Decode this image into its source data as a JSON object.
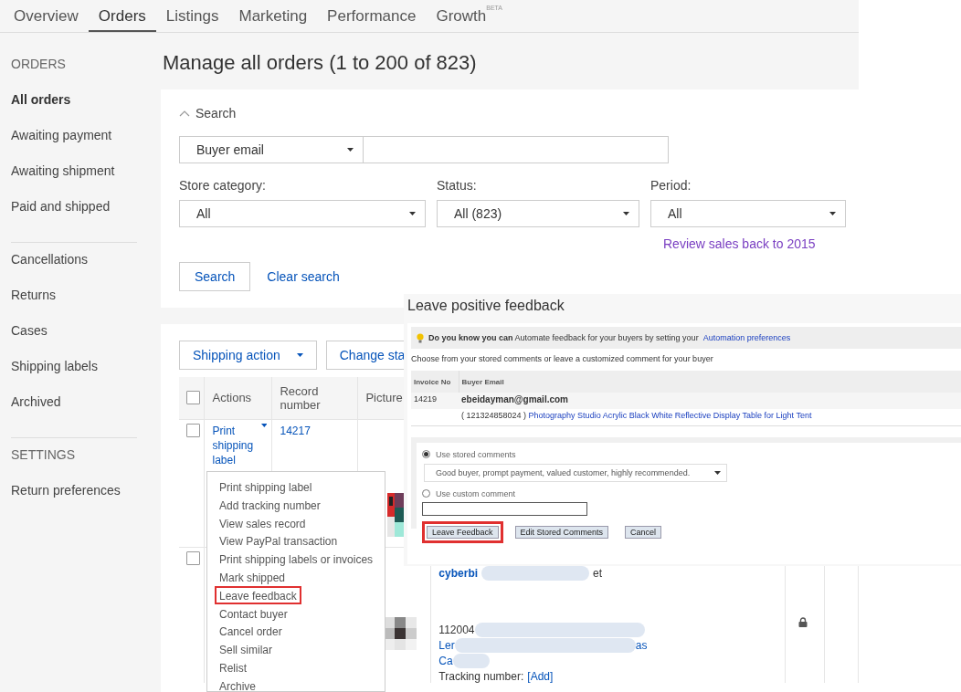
{
  "nav_tabs": [
    {
      "label": "Overview",
      "selected": false
    },
    {
      "label": "Orders",
      "selected": true
    },
    {
      "label": "Listings",
      "selected": false
    },
    {
      "label": "Marketing",
      "selected": false
    },
    {
      "label": "Performance",
      "selected": false
    },
    {
      "label": "Growth",
      "badge": "BETA",
      "selected": false
    }
  ],
  "sidebar": {
    "sections": [
      {
        "heading": "ORDERS",
        "items": [
          {
            "label": "All orders",
            "selected": true
          },
          {
            "label": "Awaiting payment",
            "selected": false
          },
          {
            "label": "Awaiting shipment",
            "selected": false
          },
          {
            "label": "Paid and shipped",
            "selected": false
          }
        ]
      },
      {
        "items": [
          {
            "label": "Cancellations",
            "selected": false
          },
          {
            "label": "Returns",
            "selected": false
          },
          {
            "label": "Cases",
            "selected": false
          },
          {
            "label": "Shipping labels",
            "selected": false
          },
          {
            "label": "Archived",
            "selected": false
          }
        ]
      },
      {
        "heading": "SETTINGS",
        "items": [
          {
            "label": "Return preferences",
            "selected": false
          }
        ]
      }
    ]
  },
  "page_title": "Manage all orders (1 to 200 of 823)",
  "search": {
    "toggle": "Search",
    "expanded": true,
    "field_select": "Buyer email",
    "filters": [
      {
        "label": "Store category:",
        "value": "All"
      },
      {
        "label": "Status:",
        "value": "All (823)"
      },
      {
        "label": "Period:",
        "value": "All"
      }
    ],
    "period_link": "Review sales back to 2015",
    "search_button": "Search",
    "clear_link": "Clear search"
  },
  "orders": {
    "all_selected": false,
    "action_buttons": [
      "Shipping action",
      "Change sta"
    ],
    "columns": [
      "Actions",
      "Record number",
      "Picture"
    ],
    "rows": [
      {
        "checked": false,
        "action": "Print shipping label",
        "record": "14217"
      },
      {
        "checked": false,
        "title": "cyberbi",
        "title_end": "et",
        "item_id": "112004",
        "link_start": "Ler",
        "link_end": "as",
        "link2": "Ca",
        "tracking_label": "Tracking number:",
        "tracking_link": "[Add]",
        "locked": true
      }
    ]
  },
  "action_menu": {
    "items": [
      {
        "label": "Print shipping label",
        "highlighted": false
      },
      {
        "label": "Add tracking number",
        "highlighted": false
      },
      {
        "label": "View sales record",
        "highlighted": false
      },
      {
        "label": "View PayPal transaction",
        "highlighted": false
      },
      {
        "label": "Print shipping labels or invoices",
        "highlighted": false
      },
      {
        "label": "Mark shipped",
        "highlighted": false
      },
      {
        "label": "Leave feedback",
        "highlighted": true
      },
      {
        "label": "Contact buyer",
        "highlighted": false
      },
      {
        "label": "Cancel order",
        "highlighted": false
      },
      {
        "label": "Sell similar",
        "highlighted": false
      },
      {
        "label": "Relist",
        "highlighted": false
      },
      {
        "label": "Archive",
        "highlighted": false
      }
    ]
  },
  "feedback_panel": {
    "title": "Leave positive feedback",
    "tip": "**Do you know you can**  Automate feedback for your buyers by setting your",
    "tip_link": "Automation preferences",
    "instruction": "Choose from your stored comments or leave a customized comment for your buyer",
    "columns": [
      "Invoice No",
      "Buyer Email"
    ],
    "invoice": "14219",
    "buyer_email": "ebeidayman@gmail.com",
    "item_number": "( 121324858024 )",
    "item_link": "Photography Studio Acrylic Black White Reflective Display Table for Light Tent",
    "options": [
      {
        "kind": "select",
        "label": "Use stored comments",
        "selected": true,
        "value": "Good buyer, prompt payment, valued customer, highly recommended."
      },
      {
        "kind": "text",
        "label": "Use custom comment",
        "selected": false
      }
    ],
    "buttons": [
      {
        "label": "Leave Feedback",
        "highlighted": true
      },
      {
        "label": "Edit Stored Comments",
        "highlighted": false
      },
      {
        "label": "Cancel",
        "highlighted": false
      }
    ]
  }
}
